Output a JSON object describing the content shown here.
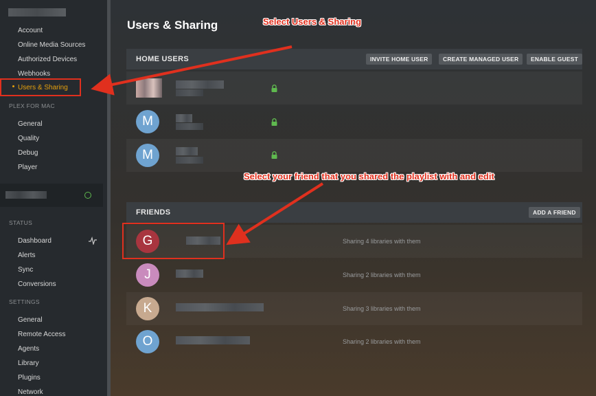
{
  "sidebar": {
    "items": [
      {
        "label": "Account"
      },
      {
        "label": "Online Media Sources"
      },
      {
        "label": "Authorized Devices"
      },
      {
        "label": "Webhooks"
      },
      {
        "label": "Users & Sharing"
      }
    ],
    "sections": {
      "plex_for_mac": "PLEX FOR MAC",
      "status": "STATUS",
      "settings": "SETTINGS"
    },
    "plex_items": [
      {
        "label": "General"
      },
      {
        "label": "Quality"
      },
      {
        "label": "Debug"
      },
      {
        "label": "Player"
      }
    ],
    "status_items": [
      {
        "label": "Dashboard"
      },
      {
        "label": "Alerts"
      },
      {
        "label": "Sync"
      },
      {
        "label": "Conversions"
      }
    ],
    "settings_items": [
      {
        "label": "General"
      },
      {
        "label": "Remote Access"
      },
      {
        "label": "Agents"
      },
      {
        "label": "Library"
      },
      {
        "label": "Plugins"
      },
      {
        "label": "Network"
      }
    ]
  },
  "main": {
    "title": "Users & Sharing",
    "home_users": {
      "header": "HOME USERS",
      "buttons": {
        "invite": "INVITE HOME USER",
        "create": "CREATE MANAGED USER",
        "guest": "ENABLE GUEST"
      },
      "users": [
        {
          "initial": ""
        },
        {
          "initial": "M"
        },
        {
          "initial": "M"
        }
      ]
    },
    "friends": {
      "header": "FRIENDS",
      "add_button": "ADD A FRIEND",
      "list": [
        {
          "initial": "G",
          "desc": "Sharing 4 libraries with them"
        },
        {
          "initial": "J",
          "desc": "Sharing 2 libraries with them"
        },
        {
          "initial": "K",
          "desc": "Sharing 3 libraries with them"
        },
        {
          "initial": "O",
          "desc": "Sharing 2 libraries with them"
        }
      ]
    }
  },
  "annotations": {
    "first": "Select Users & Sharing",
    "second": "Select your friend that you shared the playlist with and edit"
  },
  "colors": {
    "accent": "#e5a00d",
    "annotation": "#e0301e",
    "avatar_m": "#6fa3d0",
    "avatar_g": "#a8353f",
    "avatar_j": "#c98bbd",
    "avatar_k": "#c7a98f",
    "avatar_o": "#6fa3d0"
  }
}
